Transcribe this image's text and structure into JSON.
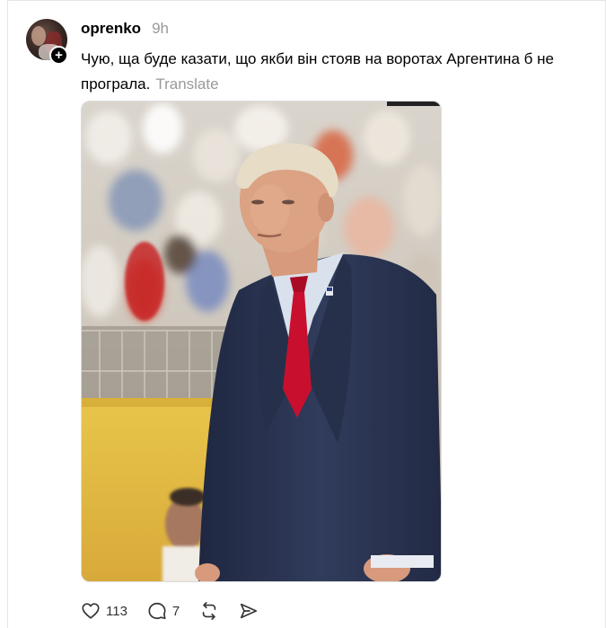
{
  "post": {
    "username": "oprenko",
    "timestamp": "9h",
    "text": "Чую, ща буде казати, що якби він стояв на воротах Аргентина б не програла.",
    "translate_label": "Translate",
    "follow_badge": "+"
  },
  "media": {
    "icon": "photo-image"
  },
  "actions": {
    "likes": "113",
    "replies": "7"
  },
  "colors": {
    "muted_text": "#999999",
    "suit": "#2b3550",
    "tie": "#c8102e"
  }
}
